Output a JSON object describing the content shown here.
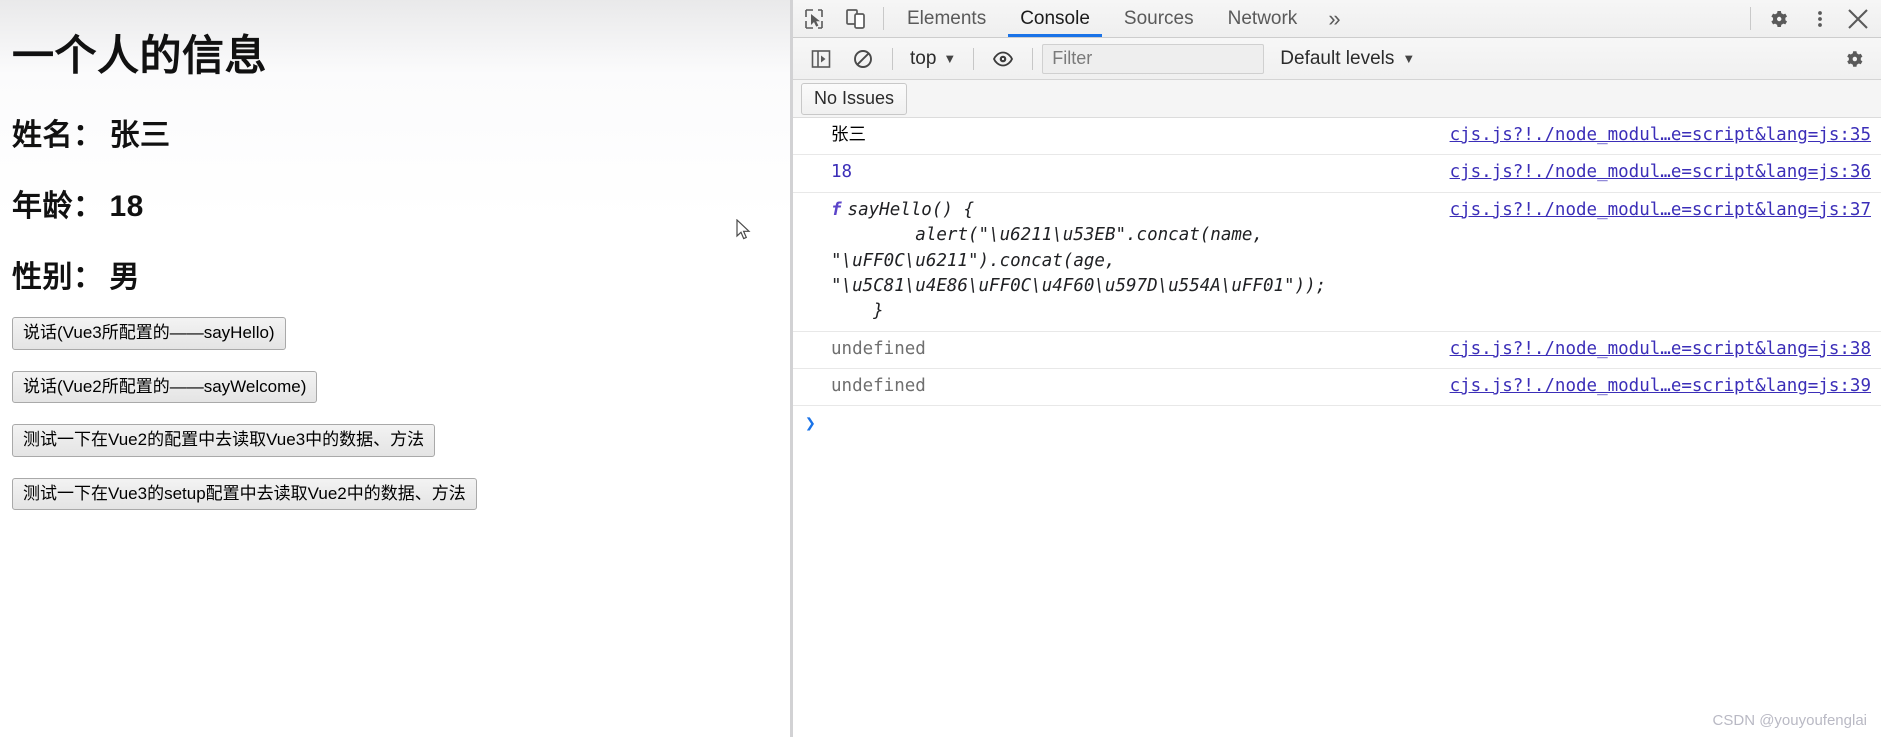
{
  "page": {
    "heading": "一个人的信息",
    "fields": [
      {
        "label": "姓名：",
        "value": "张三"
      },
      {
        "label": "年龄：",
        "value": "18"
      },
      {
        "label": "性别：",
        "value": "男"
      }
    ],
    "buttons": [
      "说话(Vue3所配置的——sayHello)",
      "说话(Vue2所配置的——sayWelcome)",
      "测试一下在Vue2的配置中去读取Vue3中的数据、方法",
      "测试一下在Vue3的setup配置中去读取Vue2中的数据、方法"
    ]
  },
  "devtools": {
    "icons": {
      "inspect": "inspect-element-icon",
      "device": "device-toolbar-icon",
      "settings": "gear-icon",
      "kebab": "more-options-icon",
      "close": "close-icon",
      "more_tabs": "»"
    },
    "tabs": [
      {
        "label": "Elements",
        "active": false
      },
      {
        "label": "Console",
        "active": true
      },
      {
        "label": "Sources",
        "active": false
      },
      {
        "label": "Network",
        "active": false
      }
    ],
    "toolbar": {
      "sidebar_toggle": "console-sidebar-icon",
      "clear": "clear-console-icon",
      "context": "top",
      "context_caret": "▼",
      "eye": "live-expression-icon",
      "filter_placeholder": "Filter",
      "levels": "Default levels",
      "levels_caret": "▼",
      "settings": "gear-icon"
    },
    "issues": {
      "label": "No Issues"
    },
    "messages": [
      {
        "type": "text",
        "text": "张三",
        "source": "cjs.js?!./node_modul…e=script&lang=js:35"
      },
      {
        "type": "number",
        "text": "18",
        "source": "cjs.js?!./node_modul…e=script&lang=js:36"
      },
      {
        "type": "fn",
        "fkey": "f",
        "text": "sayHello() {\n        alert(\"\\u6211\\u53EB\".concat(name,\n\"\\uFF0C\\u6211\").concat(age,\n\"\\u5C81\\u4E86\\uFF0C\\u4F60\\u597D\\u554A\\uFF01\"));\n    }",
        "source": "cjs.js?!./node_modul…e=script&lang=js:37"
      },
      {
        "type": "undefined",
        "text": "undefined",
        "source": "cjs.js?!./node_modul…e=script&lang=js:38"
      },
      {
        "type": "undefined",
        "text": "undefined",
        "source": "cjs.js?!./node_modul…e=script&lang=js:39"
      }
    ],
    "prompt": {
      "caret": "❯"
    }
  },
  "watermark": "CSDN @youyoufenglai",
  "colors": {
    "accent": "#1a73e8",
    "link": "#3b2eb8",
    "number": "#3b2eb8",
    "undefined": "#6f6f6f"
  }
}
